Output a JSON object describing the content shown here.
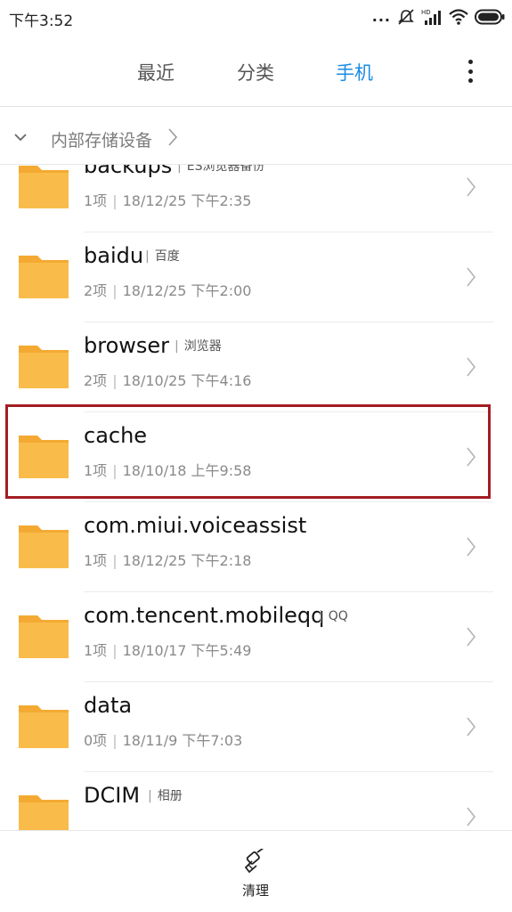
{
  "status": {
    "time": "下午3:52",
    "dots": "...",
    "icons": [
      "alarm-off-icon",
      "hd-signal-icon",
      "wifi-icon",
      "battery-icon"
    ]
  },
  "tabs": [
    {
      "label": "最近",
      "active": false
    },
    {
      "label": "分类",
      "active": false
    },
    {
      "label": "手机",
      "active": true
    }
  ],
  "colors": {
    "accent": "#1a8ce3",
    "folder": "#f9bc4b",
    "highlight": "#a31d24"
  },
  "path": {
    "label": "内部存储设备"
  },
  "files": [
    {
      "name": "backups",
      "note": "ES浏览器备份",
      "count": "1项",
      "date": "18/12/25 下午2:35"
    },
    {
      "name": "baidu",
      "note": "百度",
      "count": "2项",
      "date": "18/12/25 下午2:00"
    },
    {
      "name": "browser",
      "note": "浏览器",
      "count": "2项",
      "date": "18/10/25 下午4:16"
    },
    {
      "name": "cache",
      "note": "",
      "count": "1项",
      "date": "18/10/18 上午9:58"
    },
    {
      "name": "com.miui.voiceassist",
      "note": "",
      "count": "1项",
      "date": "18/12/25 下午2:18"
    },
    {
      "name": "com.tencent.mobileqq",
      "note": "QQ",
      "count": "1项",
      "date": "18/10/17 下午5:49"
    },
    {
      "name": "data",
      "note": "",
      "count": "0项",
      "date": "18/11/9 下午7:03"
    },
    {
      "name": "DCIM",
      "note": "相册",
      "count": "",
      "date": ""
    }
  ],
  "bottom": {
    "clean_label": "清理"
  }
}
